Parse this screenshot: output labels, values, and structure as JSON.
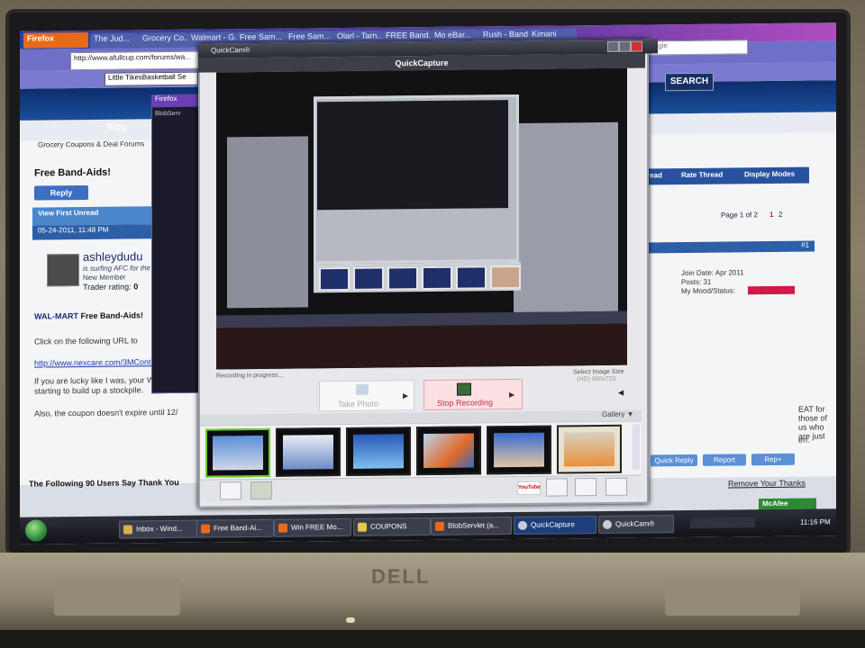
{
  "firefox": {
    "menu_label": "Firefox",
    "tabs": [
      "The Jud...",
      "Grocery Co...",
      "Walmart - G...",
      "Free Sam...",
      "Free Sam...",
      "Olarl - Tarn...",
      "FREE Band...",
      "Mo eBar...",
      "Rush - Band...",
      "Kimani"
    ],
    "url": "http://www.afullcup.com/forums/wa...",
    "bookmark_select": "Little TikesBasketball Se",
    "google_placeholder": "Google",
    "search_button": "SEARCH"
  },
  "forum": {
    "nav_blog": "Blog",
    "breadcrumb": "Grocery Coupons & Deal Forums",
    "thread_title": "Free Band-Aids!",
    "reply_button": "Reply",
    "view_first_unread": "View First Unread",
    "post_date": "05-24-2011, 11:48 PM",
    "username": "ashleydudu",
    "status_line": "is surfing AFC for the",
    "member_type": "New Member",
    "trader_label": "Trader rating:",
    "trader_value": "0",
    "walmart_logo": "WAL-MART",
    "post_heading": "Free Band-Aids!",
    "post_line1": "Click on the following URL to",
    "post_link": "http://www.nexcare.com/3MContentRe",
    "post_line2": "If you are lucky like I was, your Walmart",
    "post_line2b": "starting to build up a stockpile.",
    "post_line3": "Also, the coupon doesn't expire until 12/",
    "thanks_line": "The Following 90 Users Say Thank You",
    "right_tools": [
      "read",
      "Rate Thread",
      "Display Modes"
    ],
    "pagination_label": "Page 1 of 2",
    "page_current": "1",
    "page_next": "2",
    "post_number": "#1",
    "join_date": "Join Date: Apr 2011",
    "posts": "Posts: 31",
    "mood": "My Mood/Status:",
    "right_text1": "EAT for those of us who are just",
    "right_text2": "en.",
    "post_buttons": [
      "Quick Reply",
      "Report",
      "Rep+"
    ],
    "remove_thanks": "Remove Your Thanks"
  },
  "blob_window": {
    "title": "Firefox",
    "subtitle": "BlobServ"
  },
  "quickcam": {
    "window_title": "QuickCam®",
    "subtitle": "QuickCapture",
    "recording_status": "Recording in progress...",
    "image_size_label": "Select Image Size",
    "image_size_value": "(HD) 960x720",
    "take_photo": "Take Photo",
    "stop_recording": "Stop Recording",
    "gallery_label": "Gallery",
    "youtube_label": "YouTube",
    "gallery_thumb_count": 6
  },
  "taskbar": {
    "items": [
      "Inbox - Wind...",
      "Free Band-Ai...",
      "Win FREE Mo...",
      "COUPONS",
      "BlobServlet (a...",
      "QuickCapture",
      "QuickCam®"
    ],
    "active_item": "QuickCapture",
    "tray_antivirus": "McAfee",
    "clock": "11:16 PM"
  },
  "laptop": {
    "brand": "DELL"
  },
  "colors": {
    "firefox_tabbar": "#2c3ea0",
    "forum_blue": "#2d5fa8",
    "stop_recording": "#c0304a",
    "gallery_selected": "#6ccf2a",
    "mcafee_green": "#2c8a32"
  }
}
